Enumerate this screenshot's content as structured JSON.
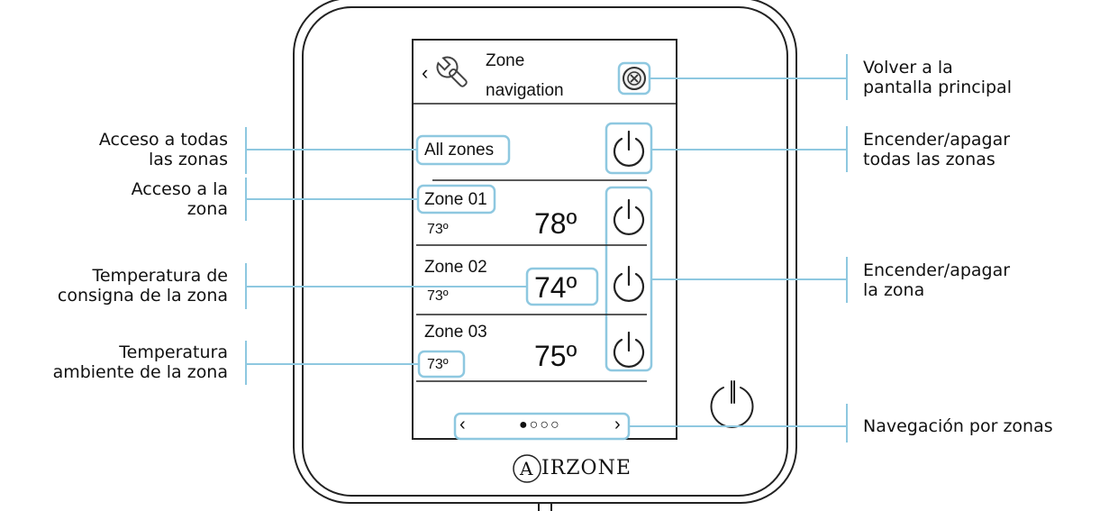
{
  "device": {
    "header": {
      "back_glyph": "‹",
      "title_line1": "Zone",
      "title_line2": "navigation",
      "settings_icon": "wrench-icon",
      "close_icon": "close-icon"
    },
    "all_zones_label": "All zones",
    "zones": [
      {
        "name": "Zone 01",
        "ambient": "73º",
        "setpoint": "78º"
      },
      {
        "name": "Zone 02",
        "ambient": "73º",
        "setpoint": "74º"
      },
      {
        "name": "Zone 03",
        "ambient": "73º",
        "setpoint": "75º"
      }
    ],
    "pager": {
      "prev": "‹",
      "dots": "●○○○",
      "next": "›"
    },
    "brand_letter": "A",
    "brand_rest": "IRZONE"
  },
  "annotations": {
    "left": [
      {
        "lines": [
          "Acceso a todas",
          "las zonas"
        ]
      },
      {
        "lines": [
          "Acceso a la",
          "zona"
        ]
      },
      {
        "lines": [
          "Temperatura de",
          "consigna de la zona"
        ]
      },
      {
        "lines": [
          "Temperatura",
          "ambiente de la zona"
        ]
      }
    ],
    "right": [
      {
        "lines": [
          "Volver a la",
          "pantalla principal"
        ]
      },
      {
        "lines": [
          "Encender/apagar",
          "todas las zonas"
        ]
      },
      {
        "lines": [
          "Encender/apagar",
          "la zona"
        ]
      },
      {
        "lines": [
          "Navegación por zonas"
        ]
      }
    ]
  },
  "colors": {
    "highlight": "#8ec8e0",
    "frame": "#222222"
  }
}
